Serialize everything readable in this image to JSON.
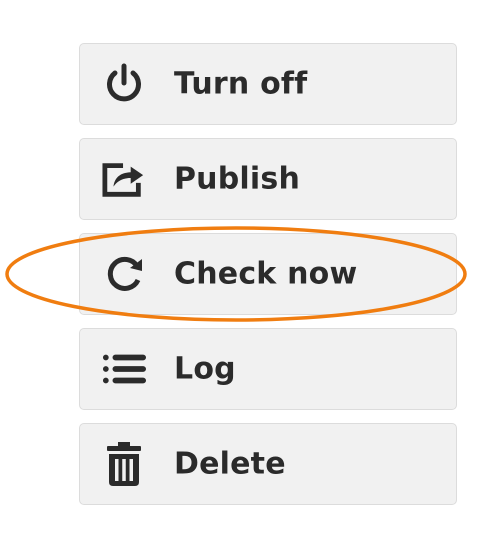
{
  "menu": {
    "items": [
      {
        "label": "Turn off",
        "icon": "power-icon"
      },
      {
        "label": "Publish",
        "icon": "share-icon"
      },
      {
        "label": "Check now",
        "icon": "refresh-icon"
      },
      {
        "label": "Log",
        "icon": "list-icon"
      },
      {
        "label": "Delete",
        "icon": "trash-icon"
      }
    ]
  },
  "colors": {
    "button_background": "#f1f1f1",
    "button_border": "#dcdcdc",
    "text": "#2b2b2b",
    "highlight": "#f07d10"
  },
  "annotation": {
    "highlighted_item": "Check now",
    "shape": "ellipse"
  }
}
